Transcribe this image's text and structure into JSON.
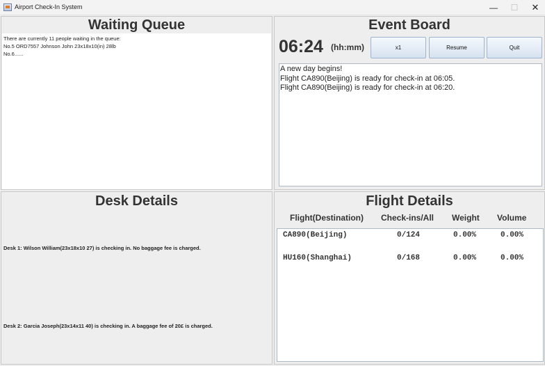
{
  "window": {
    "title": "Airport Check-In System",
    "minimize_glyph": "—",
    "maximize_glyph": "☐",
    "close_glyph": "✕"
  },
  "waiting_queue": {
    "title": "Waiting Queue",
    "lines": [
      "There are currently 11 people waiting in the queue:",
      "No.5 ORD7557 Johnson John 23x18x10(in) 28lb",
      "No.6......"
    ]
  },
  "event_board": {
    "title": "Event Board",
    "time": "06:24",
    "time_unit": "(hh:mm)",
    "buttons": {
      "speed": "x1",
      "resume": "Resume",
      "quit": "Quit"
    },
    "log": [
      "A new day begins!",
      "Flight CA890(Beijing) is ready for check-in at 06:05.",
      "Flight CA890(Beijing) is ready for check-in at 06:20."
    ]
  },
  "desk_details": {
    "title": "Desk Details",
    "desks": [
      "Desk 1: Wilson William(23x18x10 27) is checking in. No baggage fee is charged.",
      "Desk 2: Garcia Joseph(23x14x11 40) is checking in. A baggage fee of 20£ is charged."
    ]
  },
  "flight_details": {
    "title": "Flight Details",
    "columns": [
      "Flight(Destination)",
      "Check-ins/All",
      "Weight",
      "Volume"
    ],
    "rows": [
      {
        "flight": "CA890(Beijing)",
        "checkins": "0/124",
        "weight": "0.00%",
        "volume": "0.00%"
      },
      {
        "flight": "HU160(Shanghai)",
        "checkins": "0/168",
        "weight": "0.00%",
        "volume": "0.00%"
      }
    ]
  }
}
